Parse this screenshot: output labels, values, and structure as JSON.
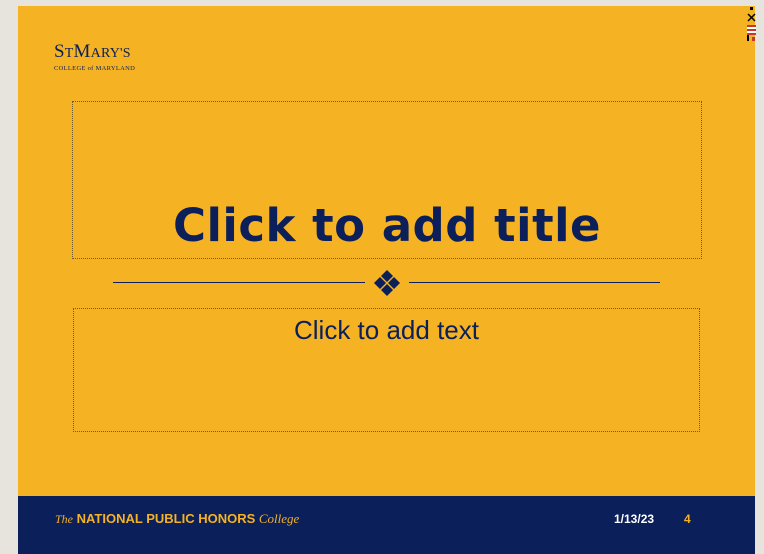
{
  "slide": {
    "logo": {
      "main_big": "S",
      "main_small": "T",
      "main_big2": "M",
      "main_small2": "ARY'S",
      "sub": "COLLEGE of MARYLAND"
    },
    "title_placeholder": "Click to add title",
    "body_placeholder": "Click to add text",
    "footer": {
      "brand_the": "The",
      "brand_main": "NATIONAL PUBLIC HONORS",
      "brand_college": "College",
      "date": "1/13/23",
      "page_number": "4"
    }
  },
  "colors": {
    "slide_background": "#f5b223",
    "navy": "#0b1f5a",
    "workspace": "#e7e3dd"
  },
  "icons": [
    "diamond-cluster-icon",
    "close-icon",
    "flag-icon"
  ]
}
